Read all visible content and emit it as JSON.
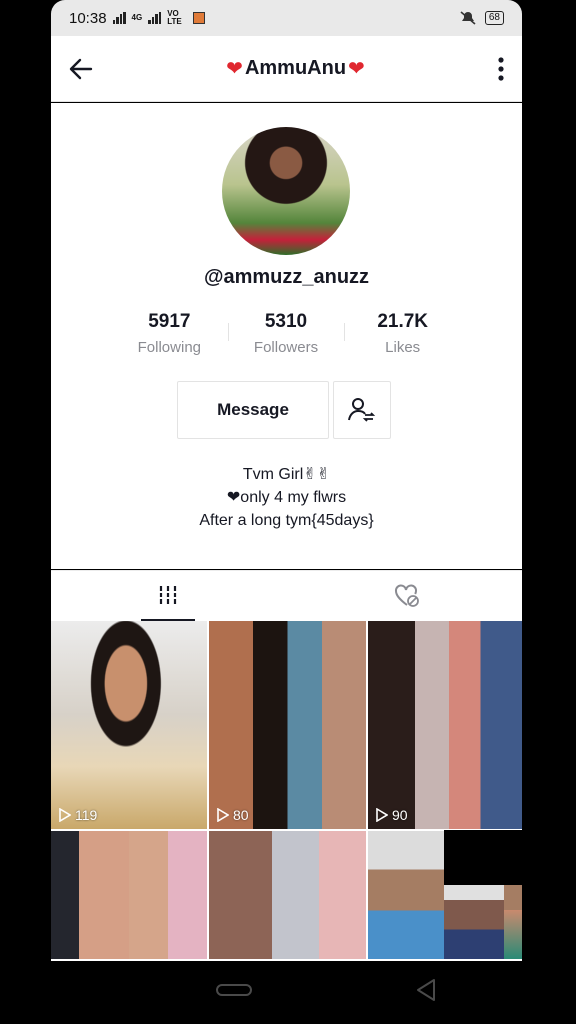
{
  "status_bar": {
    "time": "10:38",
    "net_label_1": "4G",
    "net_label_2": "VO LTE",
    "battery": "68"
  },
  "header": {
    "back_icon": "arrow-left-icon",
    "title": "AmmuAnu",
    "title_heart_left": "❤",
    "title_heart_right": "❤",
    "more_icon": "more-vertical-icon"
  },
  "profile": {
    "handle": "@ammuzz_anuzz",
    "stats": [
      {
        "number": "5917",
        "label": "Following"
      },
      {
        "number": "5310",
        "label": "Followers"
      },
      {
        "number": "21.7K",
        "label": "Likes"
      }
    ],
    "message_label": "Message",
    "follow_icon": "add-friend-icon",
    "bio": {
      "line1": "Tvm Girl✌✌",
      "line2": "❤only 4 my flwrs",
      "line3": "After a long tym{45days}"
    }
  },
  "tabs": [
    {
      "icon": "grid-icon",
      "selected": true
    },
    {
      "icon": "liked-heart-icon",
      "selected": false
    }
  ],
  "videos": [
    {
      "views": "119"
    },
    {
      "views": "80"
    },
    {
      "views": "90"
    }
  ],
  "colors": {
    "accent_heart": "#e0272f",
    "text": "#161823",
    "muted": "#8a8b91"
  }
}
